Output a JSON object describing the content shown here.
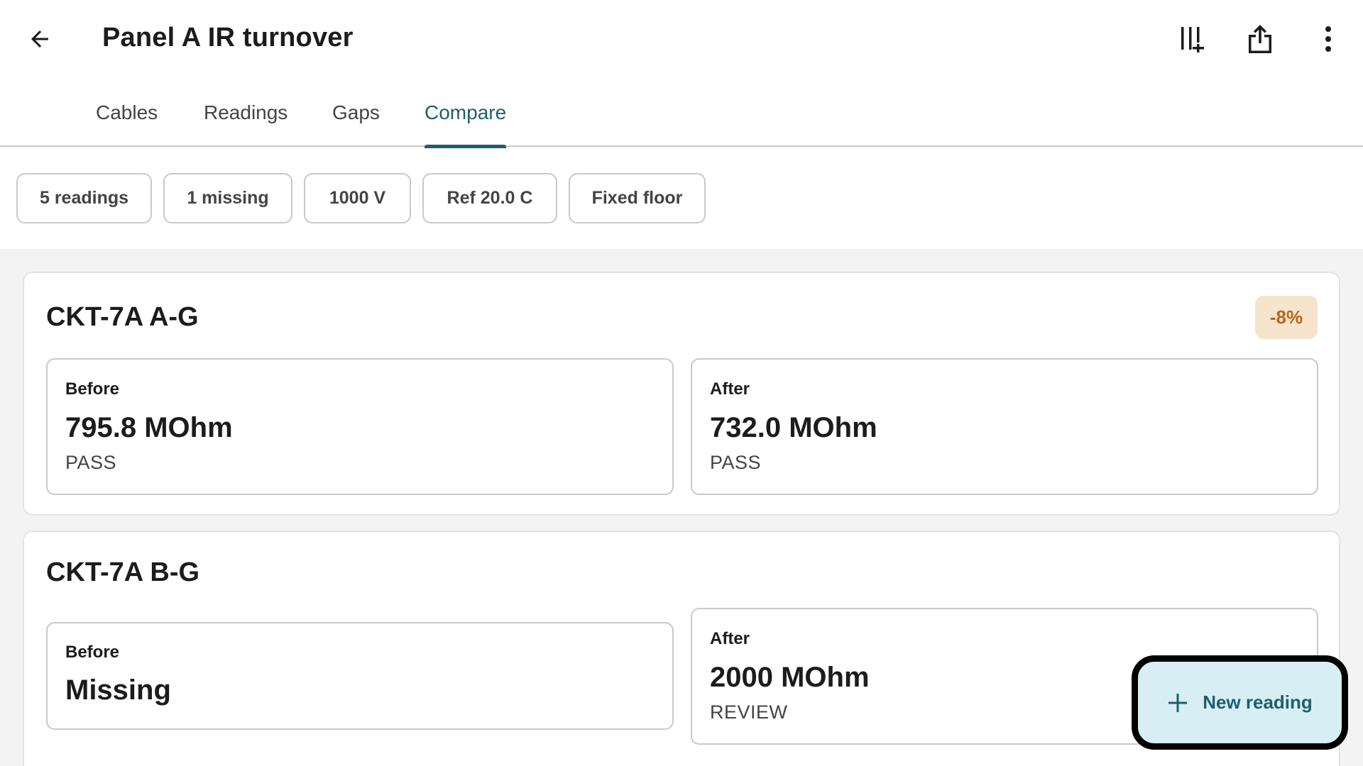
{
  "header": {
    "title": "Panel A IR turnover",
    "back_icon": "arrow-left-icon",
    "actions": [
      {
        "name": "column-add-icon"
      },
      {
        "name": "share-icon"
      },
      {
        "name": "more-vertical-icon"
      }
    ]
  },
  "tabs": [
    {
      "label": "Cables",
      "active": false
    },
    {
      "label": "Readings",
      "active": false
    },
    {
      "label": "Gaps",
      "active": false
    },
    {
      "label": "Compare",
      "active": true
    }
  ],
  "chips": [
    "5 readings",
    "1 missing",
    "1000 V",
    "Ref 20.0 C",
    "Fixed floor"
  ],
  "cards": [
    {
      "title": "CKT-7A A-G",
      "delta": "-8%",
      "before": {
        "label": "Before",
        "value": "795.8 MOhm",
        "status": "PASS"
      },
      "after": {
        "label": "After",
        "value": "732.0 MOhm",
        "status": "PASS"
      }
    },
    {
      "title": "CKT-7A B-G",
      "before": {
        "label": "Before",
        "value": "Missing"
      },
      "after": {
        "label": "After",
        "value": "2000 MOhm",
        "status": "REVIEW"
      }
    }
  ],
  "fab": {
    "label": "New reading",
    "icon": "plus-icon"
  },
  "colors": {
    "accent": "#1f5e6b",
    "badge_bg": "#f6e4cd",
    "badge_text": "#b8651a",
    "fab_bg": "#d7eef4",
    "content_bg": "#f3f3f3"
  }
}
